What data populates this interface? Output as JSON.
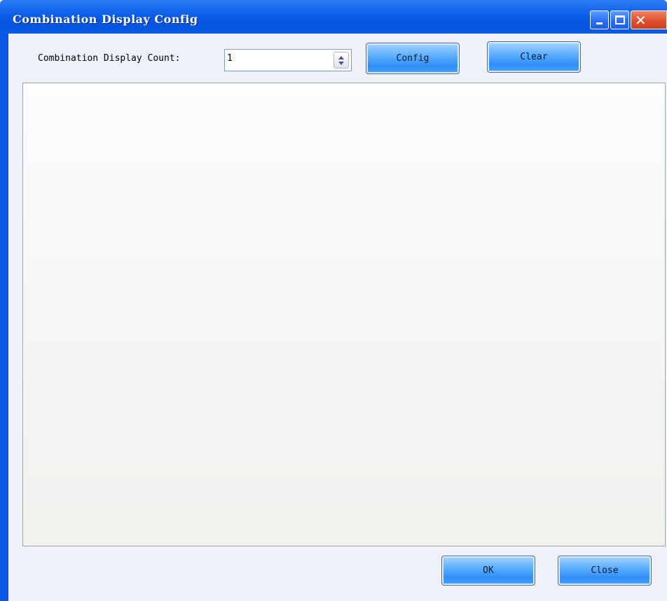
{
  "window": {
    "title": "Combination Display Config",
    "controls": {
      "minimize_icon": "minimize-icon",
      "maximize_icon": "maximize-icon",
      "close_icon": "close-icon",
      "close_glyph": "✕"
    }
  },
  "toolbar": {
    "count_label": "Combination Display Count:",
    "count_value": "1",
    "config_label": "Config",
    "clear_label": "Clear"
  },
  "footer": {
    "ok_label": "OK",
    "close_label": "Close"
  },
  "colors": {
    "titlebar": "#0a5ee9",
    "button_blue": "#4aa2ff",
    "close_red": "#e0502c",
    "client_background": "#eef1f8"
  }
}
